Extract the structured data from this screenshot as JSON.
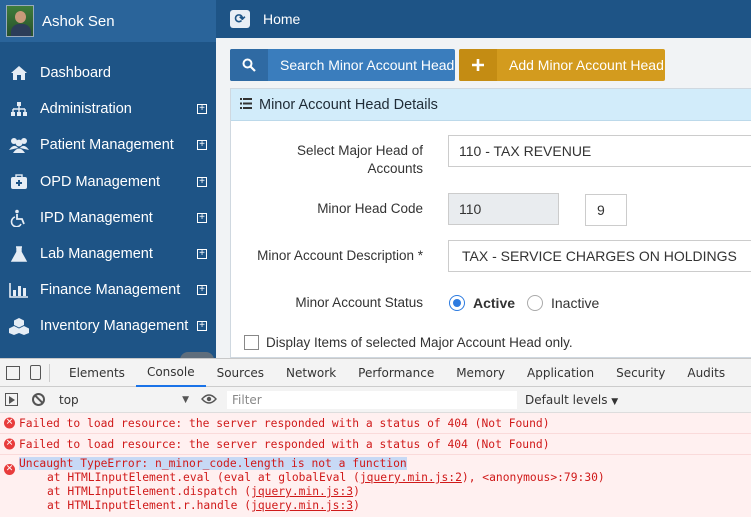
{
  "sidebar": {
    "user_name": "Ashok Sen",
    "items": [
      {
        "label": "Dashboard",
        "icon": "home-icon",
        "expandable": false
      },
      {
        "label": "Administration",
        "icon": "sitemap-icon",
        "expandable": true
      },
      {
        "label": "Patient Management",
        "icon": "users-icon",
        "expandable": true
      },
      {
        "label": "OPD Management",
        "icon": "medkit-icon",
        "expandable": true
      },
      {
        "label": "IPD Management",
        "icon": "wheelchair-icon",
        "expandable": true
      },
      {
        "label": "Lab Management",
        "icon": "flask-icon",
        "expandable": true
      },
      {
        "label": "Finance Management",
        "icon": "chart-icon",
        "expandable": true
      },
      {
        "label": "Inventory Management",
        "icon": "cubes-icon",
        "expandable": true
      }
    ]
  },
  "topbar": {
    "title": "Home"
  },
  "toolbar": {
    "search_label": "Search Minor Account Head",
    "add_label": "Add Minor Account Head"
  },
  "panel": {
    "title": "Minor Account Head Details",
    "major_head_label": "Select Major Head of Accounts",
    "major_head_value": "110 - TAX REVENUE",
    "minor_code_label": "Minor Head Code",
    "minor_code_prefix": "110",
    "minor_code_value": "9",
    "description_label": "Minor Account Description *",
    "description_value": "TAX - SERVICE CHARGES ON HOLDINGS",
    "status_label": "Minor Account Status",
    "status_active": "Active",
    "status_inactive": "Inactive",
    "status_selected": "Active",
    "checkbox_label": "Display Items of selected Major Account Head only."
  },
  "devtools": {
    "tabs": [
      "Elements",
      "Console",
      "Sources",
      "Network",
      "Performance",
      "Memory",
      "Application",
      "Security",
      "Audits"
    ],
    "active_tab": "Console",
    "context": "top",
    "filter_placeholder": "Filter",
    "levels": "Default levels",
    "messages": [
      "Failed to load resource: the server responded with a status of 404 (Not Found)",
      "Failed to load resource: the server responded with a status of 404 (Not Found)"
    ],
    "error": {
      "message": "Uncaught TypeError: n_minor_code.length is not a function",
      "trace1_prefix": "at HTMLInputElement.eval (eval at globalEval (",
      "trace1_link": "jquery.min.js:2",
      "trace1_suffix": "), <anonymous>:79:30)",
      "trace2_prefix": "at HTMLInputElement.dispatch (",
      "trace2_link": "jquery.min.js:3",
      "trace2_suffix": ")",
      "trace3_prefix": "at HTMLInputElement.r.handle (",
      "trace3_link": "jquery.min.js:3",
      "trace3_suffix": ")"
    }
  }
}
